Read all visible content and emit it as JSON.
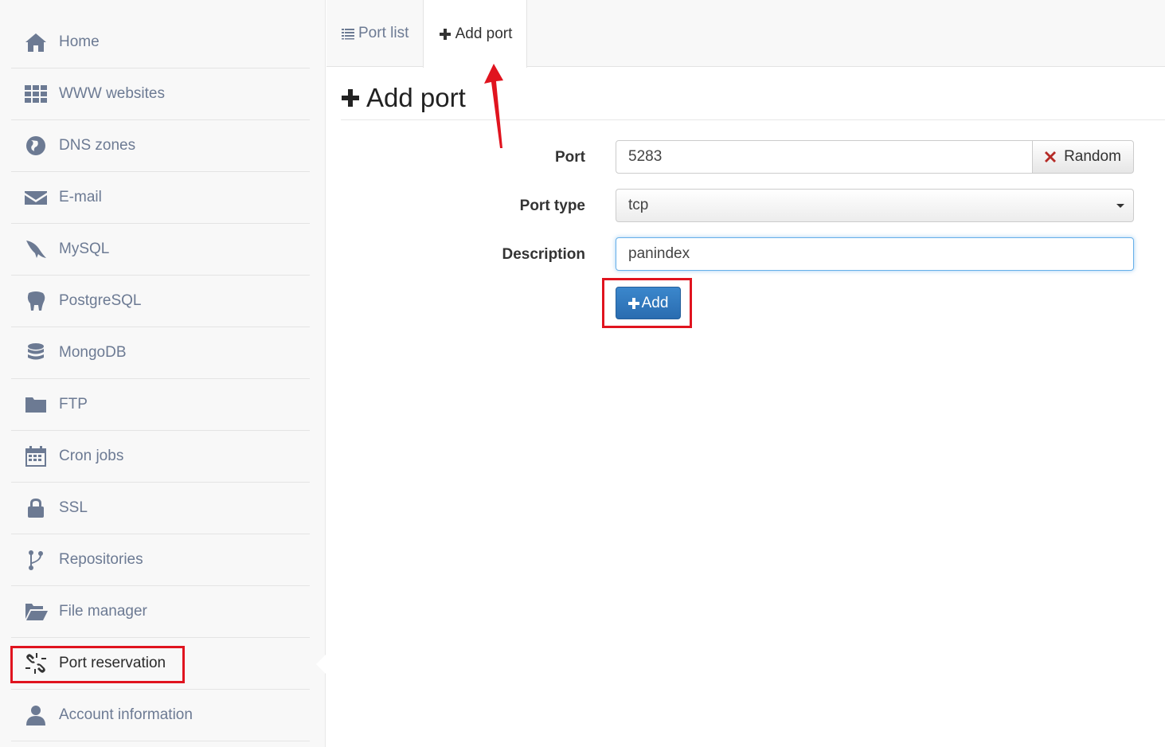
{
  "sidebar": {
    "items": [
      {
        "label": "Home",
        "icon": "home-icon"
      },
      {
        "label": "WWW websites",
        "icon": "grid-icon"
      },
      {
        "label": "DNS zones",
        "icon": "globe-icon"
      },
      {
        "label": "E-mail",
        "icon": "envelope-icon"
      },
      {
        "label": "MySQL",
        "icon": "dolphin-icon"
      },
      {
        "label": "PostgreSQL",
        "icon": "elephant-icon"
      },
      {
        "label": "MongoDB",
        "icon": "database-icon"
      },
      {
        "label": "FTP",
        "icon": "folder-icon"
      },
      {
        "label": "Cron jobs",
        "icon": "calendar-icon"
      },
      {
        "label": "SSL",
        "icon": "lock-icon"
      },
      {
        "label": "Repositories",
        "icon": "branch-icon"
      },
      {
        "label": "File manager",
        "icon": "folder-open-icon"
      },
      {
        "label": "Port reservation",
        "icon": "unlink-icon",
        "active": true
      },
      {
        "label": "Account information",
        "icon": "user-icon"
      }
    ]
  },
  "tabs": [
    {
      "label": "Port list",
      "icon": "list-icon"
    },
    {
      "label": "Add port",
      "icon": "plus-icon",
      "active": true
    }
  ],
  "page": {
    "title": "Add port"
  },
  "form": {
    "port_label": "Port",
    "port_value": "5283",
    "random_label": "Random",
    "port_type_label": "Port type",
    "port_type_value": "tcp",
    "description_label": "Description",
    "description_value": "panindex",
    "add_label": "Add"
  },
  "colors": {
    "accent": "#2f78be",
    "annotation": "#e0141f",
    "sidebar_text": "#6c7a93"
  }
}
